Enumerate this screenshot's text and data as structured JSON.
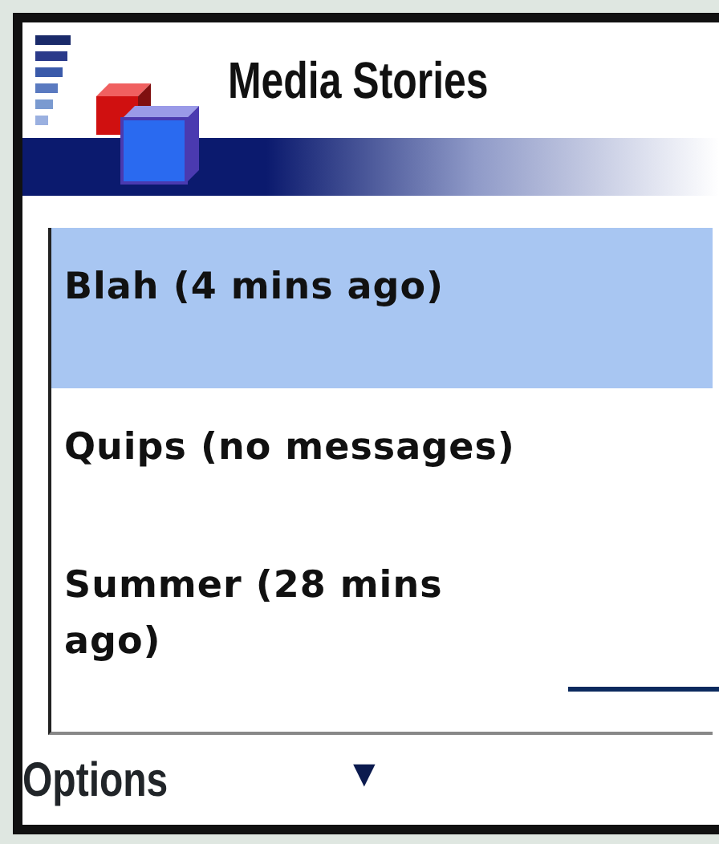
{
  "title": "Media Stories",
  "stories": [
    {
      "label": "Blah (4 mins ago)",
      "selected": true
    },
    {
      "label": "Quips (no messages)",
      "selected": false
    },
    {
      "label": "Summer (28 mins ago)",
      "selected": false
    }
  ],
  "softkeys": {
    "left": "Options",
    "center": "▼"
  }
}
